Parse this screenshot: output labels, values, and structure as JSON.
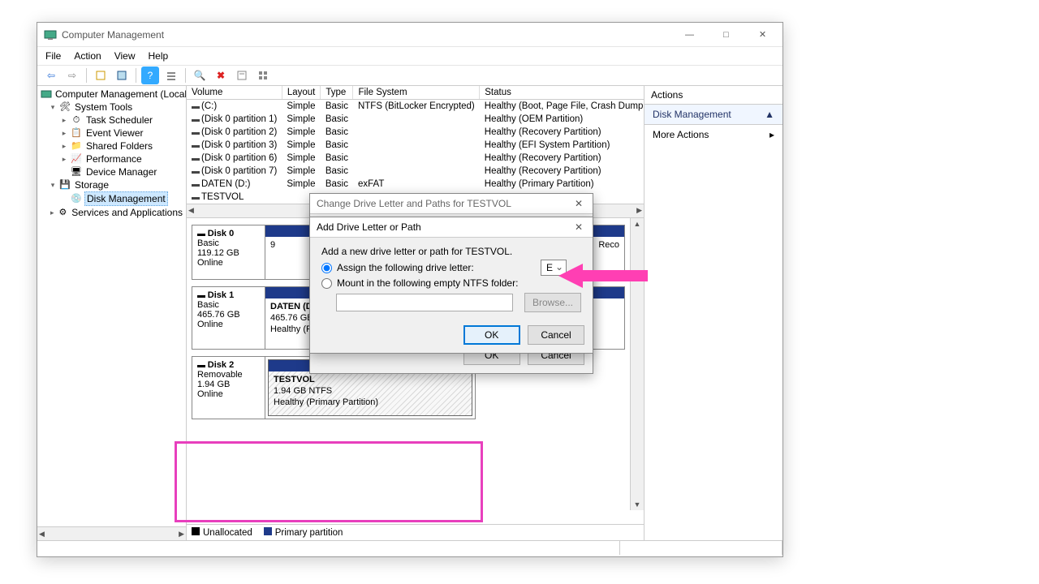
{
  "window": {
    "title": "Computer Management"
  },
  "menu": {
    "file": "File",
    "action": "Action",
    "view": "View",
    "help": "Help"
  },
  "tree": {
    "root": "Computer Management (Local",
    "system_tools": "System Tools",
    "task_scheduler": "Task Scheduler",
    "event_viewer": "Event Viewer",
    "shared_folders": "Shared Folders",
    "performance": "Performance",
    "device_manager": "Device Manager",
    "storage": "Storage",
    "disk_management": "Disk Management",
    "services_apps": "Services and Applications"
  },
  "grid": {
    "headers": {
      "volume": "Volume",
      "layout": "Layout",
      "type": "Type",
      "fs": "File System",
      "status": "Status"
    },
    "rows": [
      {
        "volume": "(C:)",
        "layout": "Simple",
        "type": "Basic",
        "fs": "NTFS (BitLocker Encrypted)",
        "status": "Healthy (Boot, Page File, Crash Dump, Prim"
      },
      {
        "volume": "(Disk 0 partition 1)",
        "layout": "Simple",
        "type": "Basic",
        "fs": "",
        "status": "Healthy (OEM Partition)"
      },
      {
        "volume": "(Disk 0 partition 2)",
        "layout": "Simple",
        "type": "Basic",
        "fs": "",
        "status": "Healthy (Recovery Partition)"
      },
      {
        "volume": "(Disk 0 partition 3)",
        "layout": "Simple",
        "type": "Basic",
        "fs": "",
        "status": "Healthy (EFI System Partition)"
      },
      {
        "volume": "(Disk 0 partition 6)",
        "layout": "Simple",
        "type": "Basic",
        "fs": "",
        "status": "Healthy (Recovery Partition)"
      },
      {
        "volume": "(Disk 0 partition 7)",
        "layout": "Simple",
        "type": "Basic",
        "fs": "",
        "status": "Healthy (Recovery Partition)"
      },
      {
        "volume": "DATEN (D:)",
        "layout": "Simple",
        "type": "Basic",
        "fs": "exFAT",
        "status": "Healthy (Primary Partition)"
      },
      {
        "volume": "TESTVOL",
        "layout": "",
        "type": "",
        "fs": "",
        "status": ""
      }
    ]
  },
  "disks": {
    "d0": {
      "title": "Disk 0",
      "type": "Basic",
      "size": "119.12 GB",
      "status": "Online",
      "vol_body": "9",
      "vol_side": "Reco"
    },
    "d1": {
      "title": "Disk 1",
      "type": "Basic",
      "size": "465.76 GB",
      "status": "Online",
      "vol_name": "DATEN  (D:)",
      "vol_size": "465.76 GB exFAT",
      "vol_status": "Healthy (Primary Partition)"
    },
    "d2": {
      "title": "Disk 2",
      "type": "Removable",
      "size": "1.94 GB",
      "status": "Online",
      "vol_name": "TESTVOL",
      "vol_size": "1.94 GB NTFS",
      "vol_status": "Healthy (Primary Partition)"
    }
  },
  "legend": {
    "unalloc": "Unallocated",
    "primary": "Primary partition"
  },
  "actions": {
    "header": "Actions",
    "dm": "Disk Management",
    "more": "More Actions"
  },
  "dlg_change": {
    "title": "Change Drive Letter and Paths for TESTVOL",
    "ok": "OK",
    "cancel": "Cancel"
  },
  "dlg_add": {
    "title": "Add Drive Letter or Path",
    "desc": "Add a new drive letter or path for TESTVOL.",
    "opt_assign": "Assign the following drive letter:",
    "opt_mount": "Mount in the following empty NTFS folder:",
    "letter": "E",
    "browse": "Browse...",
    "ok": "OK",
    "cancel": "Cancel"
  }
}
